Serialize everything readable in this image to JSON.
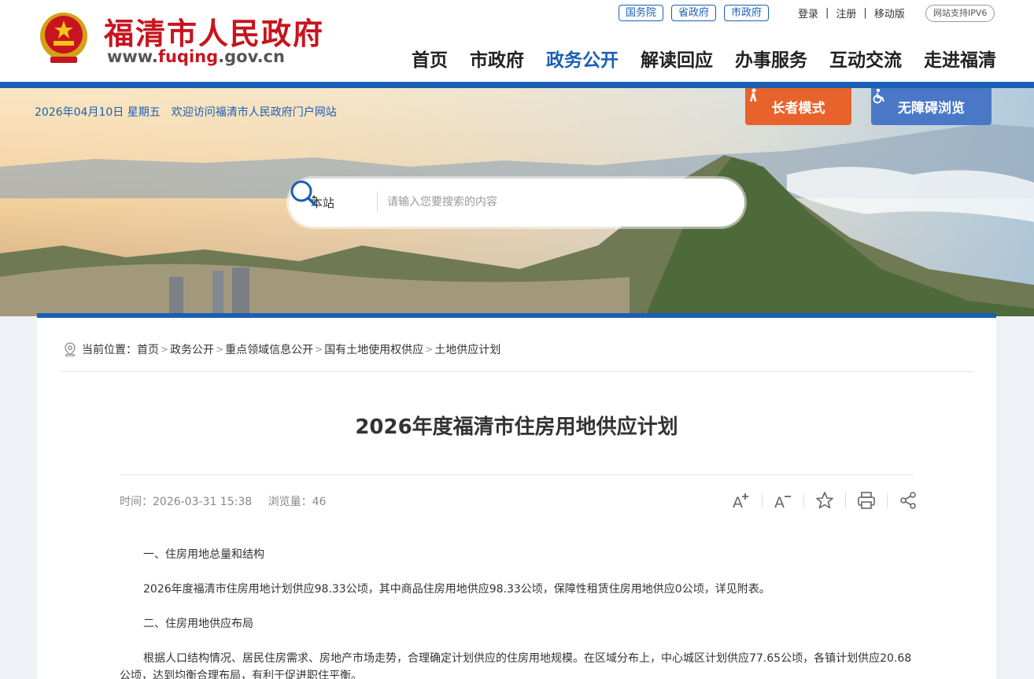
{
  "header": {
    "site_title": "福清市人民政府",
    "site_url_prefix": "www.",
    "site_url_accent": "fuqing",
    "site_url_suffix": ".gov.cn",
    "top_links": [
      "国务院",
      "省政府",
      "市政府"
    ],
    "auth": {
      "login": "登录",
      "register": "注册",
      "mobile": "移动版"
    },
    "ipv6_badge": "网站支持IPV6",
    "nav": [
      "首页",
      "市政府",
      "政务公开",
      "解读回应",
      "办事服务",
      "互动交流",
      "走进福清"
    ],
    "active_nav": "政务公开"
  },
  "banner": {
    "date": "2026年04月10日 星期五",
    "welcome": "欢迎访问福清市人民政府门户网站",
    "elder_mode": "长者模式",
    "accessibility": "无障碍浏览",
    "search_scope": "本站",
    "search_placeholder": "请输入您要搜索的内容"
  },
  "breadcrumb": {
    "label": "当前位置：",
    "items": [
      "首页",
      "政务公开",
      "重点领域信息公开",
      "国有土地使用权供应",
      "土地供应计划"
    ]
  },
  "article": {
    "title": "2026年度福清市住房用地供应计划",
    "time_label": "时间：",
    "time": "2026-03-31 15:38",
    "views_label": "浏览量：",
    "views": "46",
    "paragraphs": [
      "一、住房用地总量和结构",
      "2026年度福清市住房用地计划供应98.33公顷，其中商品住房用地供应98.33公顷，保障性租赁住房用地供应0公顷，详见附表。",
      "二、住房用地供应布局",
      "根据人口结构情况、居民住房需求、房地产市场走势，合理确定计划供应的住房用地规模。在区域分布上，中心城区计划供应77.65公顷，各镇计划供应20.68公顷，达到均衡合理布局，有利于促进职住平衡。"
    ]
  },
  "colors": {
    "brand_blue": "#1a5fb4",
    "brand_red": "#c8141e",
    "elder_orange": "#e8632b",
    "access_blue": "#4a78c7"
  }
}
